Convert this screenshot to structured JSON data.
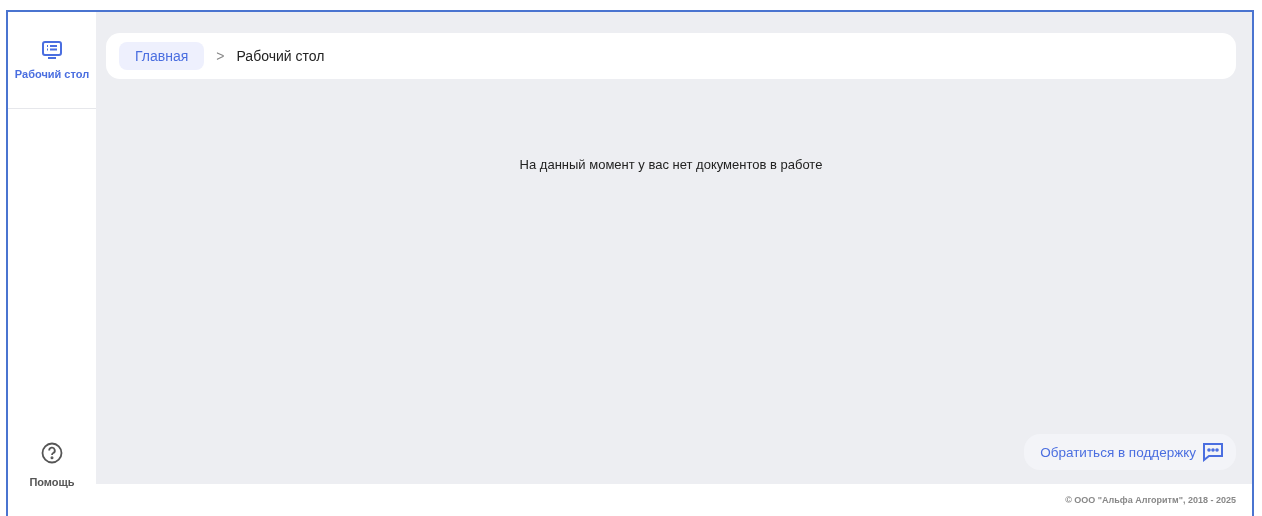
{
  "sidebar": {
    "items": [
      {
        "kind": "desktop",
        "label": "Рабочий стол",
        "selected": true
      }
    ],
    "help": {
      "label": "Помощь"
    }
  },
  "breadcrumbs": [
    {
      "label": "Главная",
      "kind": "link"
    },
    {
      "label": "Рабочий стол",
      "kind": "current"
    }
  ],
  "breadcrumb_separator": ">",
  "empty_message": "На данный момент у вас нет документов в работе",
  "support_button": {
    "label": "Обратиться в поддержку"
  },
  "footer": "© ООО \"Альфа Алгоритм\", 2018 - 2025"
}
